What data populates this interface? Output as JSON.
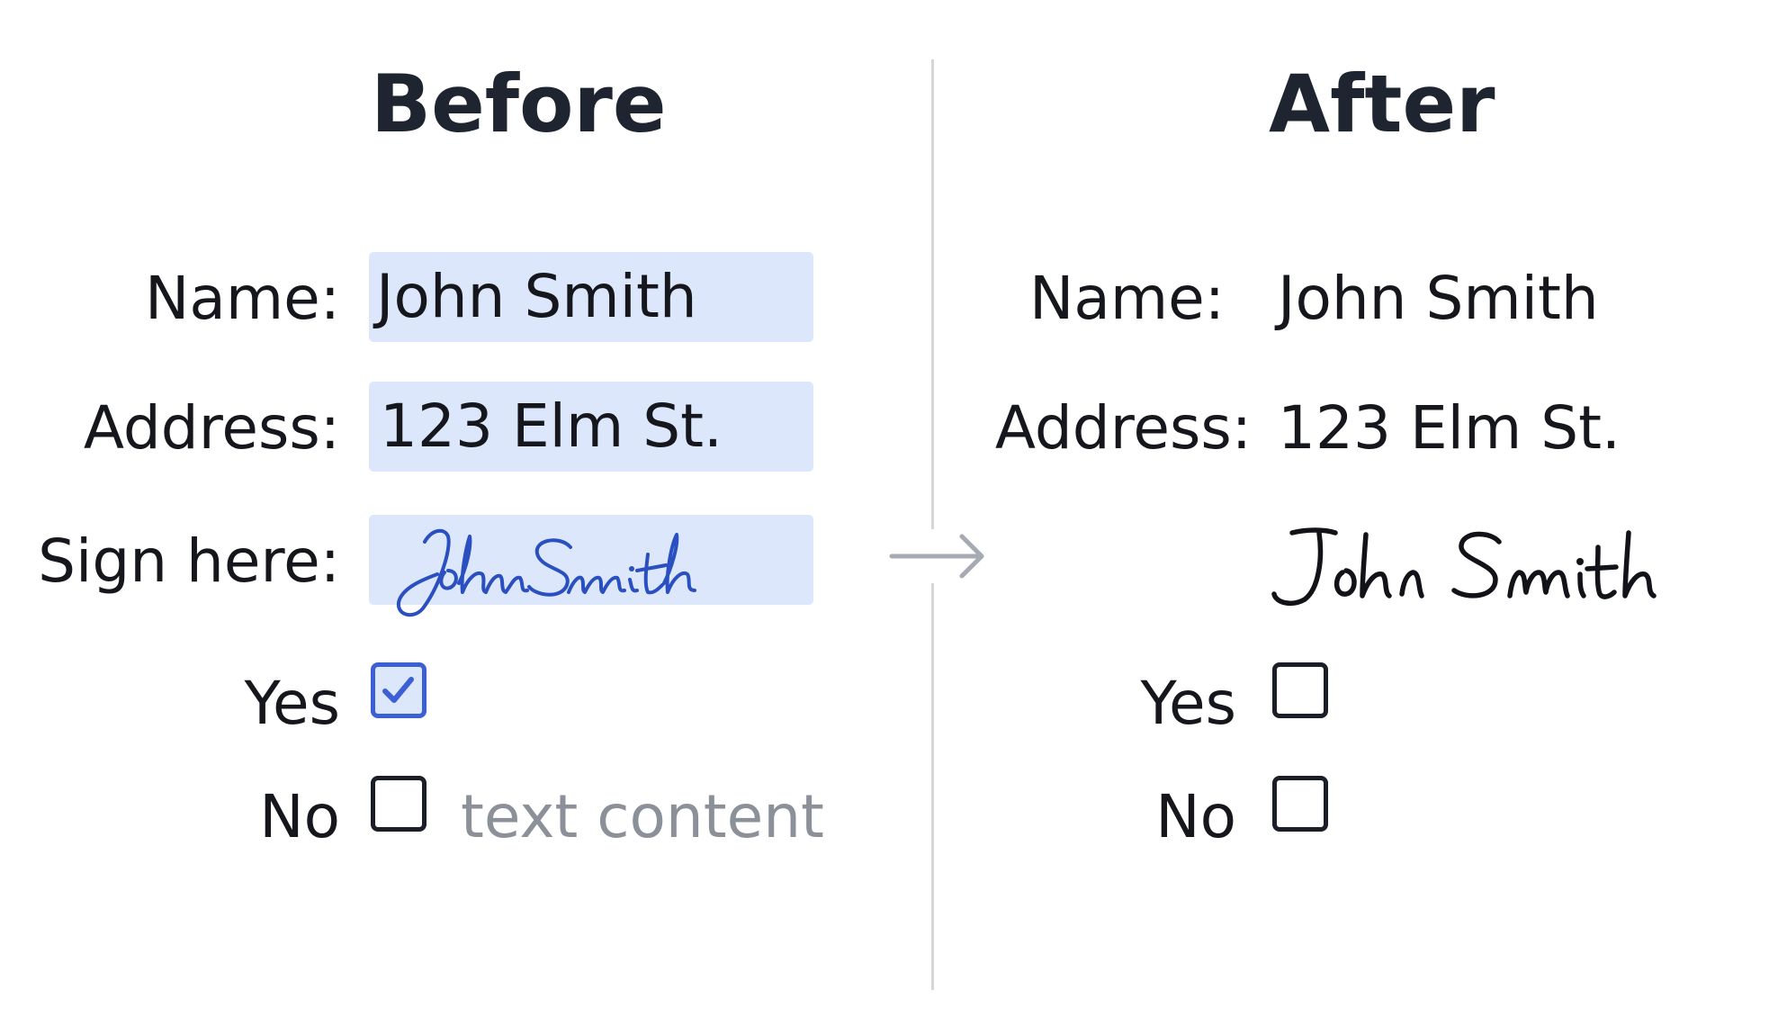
{
  "before": {
    "title": "Before",
    "fields": [
      {
        "label": "Name:",
        "value": "John Smith"
      },
      {
        "label": "Address:",
        "value": "123 Elm St."
      }
    ],
    "signature": {
      "label": "Sign here:",
      "value": "John Smith"
    },
    "checkboxes": [
      {
        "label": "Yes",
        "checked": true
      },
      {
        "label": "No",
        "checked": false
      }
    ],
    "hint": "text content"
  },
  "after": {
    "title": "After",
    "fields": [
      {
        "label": "Name:",
        "value": "John Smith"
      },
      {
        "label": "Address:",
        "value": "123 Elm St."
      }
    ],
    "signature": {
      "value": "John Smith"
    },
    "checkboxes": [
      {
        "label": "Yes",
        "checked": false
      },
      {
        "label": "No",
        "checked": false
      }
    ]
  },
  "icons": {
    "arrow": "arrow-right-icon",
    "checkmark": "checkmark-icon"
  },
  "colors": {
    "field_background": "#dde7fb",
    "accent_blue": "#3b5fd4",
    "signature_blue": "#2a4fc0",
    "hint_gray": "#8c9099",
    "divider": "#d4d6da",
    "text": "#15171c"
  }
}
